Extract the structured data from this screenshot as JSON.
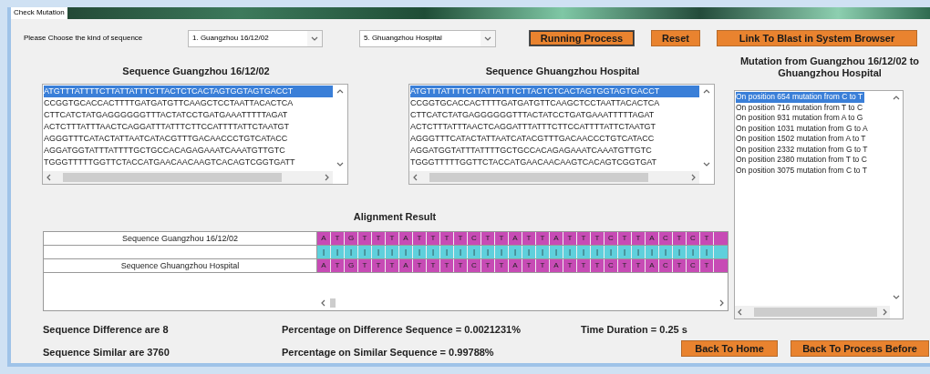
{
  "window": {
    "title": "Check Mutation"
  },
  "chooser": {
    "label": "Please Choose the kind of sequence",
    "first": "1. Guangzhou 16/12/02",
    "second": "5. Ghuangzhou Hospital"
  },
  "buttons": [
    {
      "label": "Running Process",
      "focused": true
    },
    {
      "label": "Reset",
      "focused": false
    },
    {
      "label": "Link To Blast in System Browser",
      "focused": false
    }
  ],
  "sequence_panels": [
    {
      "title": "Sequence Guangzhou 16/12/02",
      "lines": [
        {
          "text": "ATGTTTATTTTCTTATTATTTCTTACTCTCACTAGTGGTAGTGACCT",
          "selected": true
        },
        {
          "text": "CCGGTGCACCACTTTTGATGATGTTCAAGCTCCTAATTACACTCA",
          "selected": false
        },
        {
          "text": "CTTCATCTATGAGGGGGGTTTACTATCCTGATGAAATTTTTAGAT",
          "selected": false
        },
        {
          "text": "ACTCTTTATTTAACTCAGGATTTATTTCTTCCATTTTATTCTAATGT",
          "selected": false
        },
        {
          "text": "AGGGTTTCATACTATTAATCATACGTTTGACAACCCTGTCATACC",
          "selected": false
        },
        {
          "text": "AGGATGGTATTTATTTTGCTGCCACAGAGAAATCAAATGTTGTC",
          "selected": false
        },
        {
          "text": "TGGGTTTTTGGTTCTACCATGAACAACAAGTCACAGTCGGTGATT",
          "selected": false
        }
      ]
    },
    {
      "title": "Sequence Ghuangzhou Hospital",
      "lines": [
        {
          "text": "ATGTTTATTTTCTTATTATTTCTTACTCTCACTAGTGGTAGTGACCT",
          "selected": true
        },
        {
          "text": "CCGGTGCACCACTTTTGATGATGTTCAAGCTCCTAATTACACTCA",
          "selected": false
        },
        {
          "text": "CTTCATCTATGAGGGGGGTTTACTATCCTGATGAAATTTTTAGAT",
          "selected": false
        },
        {
          "text": "ACTCTTTATTTAACTCAGGATTTATTTCTTCCATTTTATTCTAATGT",
          "selected": false
        },
        {
          "text": "AGGGTTTCATACTATTAATCATACGTTTGACAACCCTGTCATACC",
          "selected": false
        },
        {
          "text": "AGGATGGTATTTATTTTGCTGCCACAGAGAAATCAAATGTTGTC",
          "selected": false
        },
        {
          "text": "TGGGTTTTTGGTTCTACCATGAACAACAAGTCACAGTCGGTGAT",
          "selected": false
        }
      ]
    }
  ],
  "mutations": {
    "title": "Mutation from Guangzhou 16/12/02 to Ghuangzhou Hospital",
    "items": [
      {
        "text": "On position 654 mutation from C to T",
        "selected": true
      },
      {
        "text": "On position 716 mutation from T to C",
        "selected": false
      },
      {
        "text": "On position 931 mutation from A to G",
        "selected": false
      },
      {
        "text": "On position 1031 mutation from G to A",
        "selected": false
      },
      {
        "text": "On position 1502 mutation from A to T",
        "selected": false
      },
      {
        "text": "On position 2332 mutation from G to T",
        "selected": false
      },
      {
        "text": "On position 2380 mutation from T to C",
        "selected": false
      },
      {
        "text": "On position 3075 mutation from C to T",
        "selected": false
      }
    ]
  },
  "alignment": {
    "title": "Alignment Result",
    "rows": [
      {
        "kind": "sequence",
        "label": "Sequence Guangzhou 16/12/02",
        "cells": [
          "A",
          "T",
          "G",
          "T",
          "T",
          "T",
          "A",
          "T",
          "T",
          "T",
          "T",
          "C",
          "T",
          "T",
          "A",
          "T",
          "T",
          "A",
          "T",
          "T",
          "T",
          "C",
          "T",
          "T",
          "A",
          "C",
          "T",
          "C",
          "T"
        ]
      },
      {
        "kind": "match",
        "cells": [
          "|",
          "|",
          "|",
          "|",
          "|",
          "|",
          "|",
          "|",
          "|",
          "|",
          "|",
          "|",
          "|",
          "|",
          "|",
          "|",
          "|",
          "|",
          "|",
          "|",
          "|",
          "|",
          "|",
          "|",
          "|",
          "|",
          "|",
          "|",
          "|"
        ]
      },
      {
        "kind": "sequence",
        "label": "Sequence Ghuangzhou Hospital",
        "cells": [
          "A",
          "T",
          "G",
          "T",
          "T",
          "T",
          "A",
          "T",
          "T",
          "T",
          "T",
          "C",
          "T",
          "T",
          "A",
          "T",
          "T",
          "A",
          "T",
          "T",
          "T",
          "C",
          "T",
          "T",
          "A",
          "C",
          "T",
          "C",
          "T"
        ]
      }
    ]
  },
  "stats": [
    {
      "text": "Sequence Difference are 8"
    },
    {
      "text": "Percentage on Difference Sequence = 0.0021231%"
    },
    {
      "text": "Time Duration = 0.25 s"
    },
    {
      "text": "Sequence Similar are 3760"
    },
    {
      "text": "Percentage on Similar Sequence = 0.99788%"
    }
  ],
  "nav_buttons": [
    "Back To Home",
    "Back To Process Before"
  ]
}
